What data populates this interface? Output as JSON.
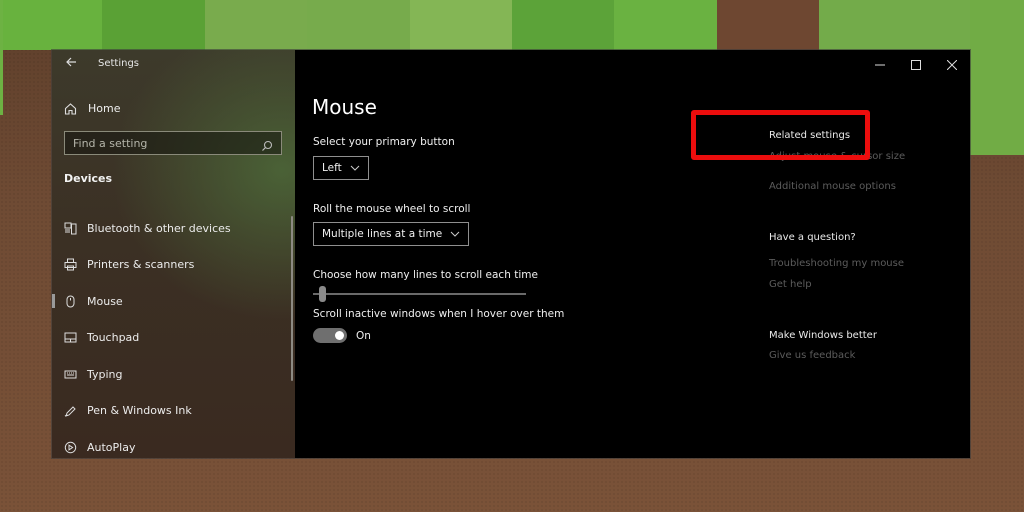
{
  "background": {
    "top_tiles": [
      "#68b23e",
      "#5aa135",
      "#79ab4d",
      "#77ab4c",
      "#84b655",
      "#5ca339",
      "#6ab241",
      "#6e4731",
      "#73ab4a",
      "#73ab4a"
    ]
  },
  "window": {
    "title": "Settings",
    "controls": {
      "minimize": "–",
      "maximize": "☐",
      "close": "✕"
    }
  },
  "sidebar": {
    "home_label": "Home",
    "search_placeholder": "Find a setting",
    "section_header": "Devices",
    "items": [
      {
        "label": "Bluetooth & other devices",
        "icon": "bluetooth-devices-icon",
        "active": false
      },
      {
        "label": "Printers & scanners",
        "icon": "printer-icon",
        "active": false
      },
      {
        "label": "Mouse",
        "icon": "mouse-icon",
        "active": true
      },
      {
        "label": "Touchpad",
        "icon": "touchpad-icon",
        "active": false
      },
      {
        "label": "Typing",
        "icon": "keyboard-icon",
        "active": false
      },
      {
        "label": "Pen & Windows Ink",
        "icon": "pen-icon",
        "active": false
      },
      {
        "label": "AutoPlay",
        "icon": "autoplay-icon",
        "active": false
      }
    ]
  },
  "main": {
    "page_title": "Mouse",
    "primary_button": {
      "label": "Select your primary button",
      "value": "Left"
    },
    "wheel_scroll": {
      "label": "Roll the mouse wheel to scroll",
      "value": "Multiple lines at a time"
    },
    "lines_to_scroll": {
      "label": "Choose how many lines to scroll each time",
      "value_fraction": 0.03
    },
    "scroll_inactive": {
      "label": "Scroll inactive windows when I hover over them",
      "state": "On",
      "enabled": true
    }
  },
  "related": {
    "related_settings_header": "Related settings",
    "related_links": [
      "Adjust mouse & cursor size",
      "Additional mouse options"
    ],
    "question_header": "Have a question?",
    "question_links": [
      "Troubleshooting my mouse",
      "Get help"
    ],
    "better_header": "Make Windows better",
    "better_links": [
      "Give us feedback"
    ]
  },
  "annotation": {
    "highlight_color": "#ec0d0d",
    "highlighted_item": "Additional mouse options"
  }
}
